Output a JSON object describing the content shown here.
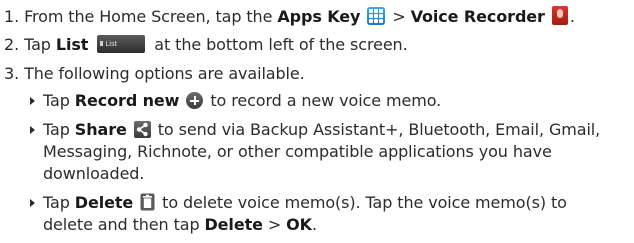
{
  "steps": [
    {
      "number": "1.",
      "text_a": "From the Home Screen, tap the ",
      "bold_a": "Apps Key",
      "text_b": " > ",
      "bold_b": "Voice Recorder",
      "text_c": "."
    },
    {
      "number": "2.",
      "text_a": "Tap ",
      "bold_a": "List",
      "button_label": "List",
      "text_b": " at the bottom left of the screen."
    },
    {
      "number": "3.",
      "text_a": "The following options are available."
    }
  ],
  "options": [
    {
      "text_a": "Tap ",
      "bold_a": "Record new",
      "text_b": " to record a new voice memo."
    },
    {
      "text_a": "Tap ",
      "bold_a": "Share",
      "text_b": " to send via Backup Assistant+, Bluetooth, Email, Gmail,",
      "line2": "Messaging, Richnote, or other compatible applications you have",
      "line3": "downloaded."
    },
    {
      "text_a": "Tap ",
      "bold_a": "Delete",
      "text_b": " to delete voice memo(s). Tap the voice memo(s) to",
      "line2_a": "delete and then tap ",
      "line2_bold_a": "Delete",
      "line2_b": " > ",
      "line2_bold_b": "OK",
      "line2_c": "."
    }
  ],
  "icons": {
    "apps_key": "apps-grid-icon",
    "voice_recorder": "voice-recorder-icon",
    "list_button": "list-button-icon",
    "record_new": "plus-circle-icon",
    "share": "share-icon",
    "delete": "trash-icon"
  },
  "colors": {
    "text": "#2c2c2c",
    "apps_key_blue": "#2a8fd8",
    "voice_recorder_red": "#c42a1f"
  }
}
